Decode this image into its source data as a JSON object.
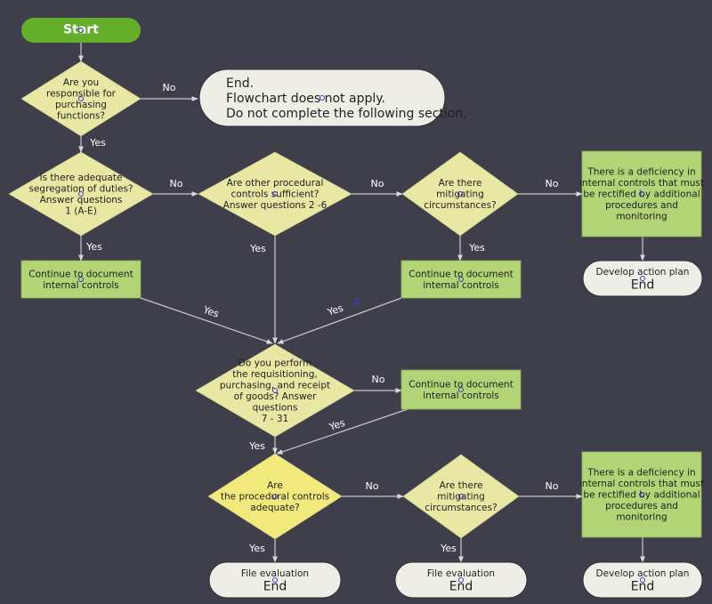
{
  "diagram": {
    "colors": {
      "background": "#3f3f4b",
      "start": "#65ae2c",
      "decision": "#e8e8a4",
      "decision_highlight": "#f2e97c",
      "process": "#b2d376",
      "terminal": "#efeee6",
      "edge": "#c8c8c8"
    },
    "nodes": [
      {
        "id": "start",
        "type": "start",
        "lines": [
          "Start"
        ]
      },
      {
        "id": "q-responsible",
        "type": "decision",
        "lines": [
          "Are you",
          "responsible for",
          "purchasing",
          "functions?"
        ]
      },
      {
        "id": "end-not-apply",
        "type": "terminal",
        "lines": [
          "End.",
          "Flowchart does not apply.",
          "Do not complete the following section."
        ]
      },
      {
        "id": "q-segregation",
        "type": "decision",
        "lines": [
          "Is there adequate",
          "segregation of duties?",
          "Answer questions",
          "1 (A-E)"
        ]
      },
      {
        "id": "q-other-controls",
        "type": "decision",
        "lines": [
          "Are other procedural",
          "controls sufficient?",
          "Answer questions 2 -6"
        ]
      },
      {
        "id": "q-mitigating-1",
        "type": "decision",
        "lines": [
          "Are there",
          "mitigating",
          "circumstances?"
        ]
      },
      {
        "id": "deficiency-1",
        "type": "process",
        "lines": [
          "There is a deficiency in",
          "internal controls that must",
          "be rectified by additional",
          "procedures and",
          "monitoring"
        ]
      },
      {
        "id": "continue-1",
        "type": "process",
        "lines": [
          "Continue to document",
          "internal controls"
        ]
      },
      {
        "id": "continue-2",
        "type": "process",
        "lines": [
          "Continue to document",
          "internal controls"
        ]
      },
      {
        "id": "action-plan-1",
        "type": "terminal",
        "lines": [
          "Develop action plan"
        ],
        "sub": "End"
      },
      {
        "id": "q-requisitioning",
        "type": "decision",
        "lines": [
          "Do you perform",
          "the requisitioning,",
          "purchasing, and receipt",
          "of goods? Answer",
          "questions",
          "7 - 31"
        ]
      },
      {
        "id": "continue-3",
        "type": "process",
        "lines": [
          "Continue to document",
          "internal controls"
        ]
      },
      {
        "id": "q-procedural-adequate",
        "type": "decision_highlight",
        "lines": [
          "Are",
          "the procedural controls",
          "adequate?"
        ]
      },
      {
        "id": "q-mitigating-2",
        "type": "decision",
        "lines": [
          "Are there",
          "mitigating",
          "circumstances?"
        ]
      },
      {
        "id": "deficiency-2",
        "type": "process",
        "lines": [
          "There is a deficiency in",
          "internal controls that must",
          "be rectified by additional",
          "procedures and",
          "monitoring"
        ]
      },
      {
        "id": "file-eval-1",
        "type": "terminal",
        "lines": [
          "File evaluation"
        ],
        "sub": "End"
      },
      {
        "id": "file-eval-2",
        "type": "terminal",
        "lines": [
          "File evaluation"
        ],
        "sub": "End"
      },
      {
        "id": "action-plan-2",
        "type": "terminal",
        "lines": [
          "Develop action plan"
        ],
        "sub": "End"
      }
    ],
    "edges": [
      {
        "from": "start",
        "to": "q-responsible",
        "label": ""
      },
      {
        "from": "q-responsible",
        "to": "end-not-apply",
        "label": "No"
      },
      {
        "from": "q-responsible",
        "to": "q-segregation",
        "label": "Yes"
      },
      {
        "from": "q-segregation",
        "to": "q-other-controls",
        "label": "No"
      },
      {
        "from": "q-segregation",
        "to": "continue-1",
        "label": "Yes"
      },
      {
        "from": "q-other-controls",
        "to": "q-mitigating-1",
        "label": "No"
      },
      {
        "from": "q-other-controls",
        "to": "q-requisitioning",
        "label": "Yes"
      },
      {
        "from": "q-mitigating-1",
        "to": "deficiency-1",
        "label": "No"
      },
      {
        "from": "q-mitigating-1",
        "to": "continue-2",
        "label": "Yes"
      },
      {
        "from": "deficiency-1",
        "to": "action-plan-1",
        "label": ""
      },
      {
        "from": "continue-1",
        "to": "q-requisitioning",
        "label": "Yes"
      },
      {
        "from": "continue-2",
        "to": "q-requisitioning",
        "label": "Yes"
      },
      {
        "from": "q-requisitioning",
        "to": "continue-3",
        "label": "No"
      },
      {
        "from": "q-requisitioning",
        "to": "q-procedural-adequate",
        "label": "Yes"
      },
      {
        "from": "continue-3",
        "to": "q-procedural-adequate",
        "label": "Yes"
      },
      {
        "from": "q-procedural-adequate",
        "to": "q-mitigating-2",
        "label": "No"
      },
      {
        "from": "q-procedural-adequate",
        "to": "file-eval-1",
        "label": "Yes"
      },
      {
        "from": "q-mitigating-2",
        "to": "deficiency-2",
        "label": "No"
      },
      {
        "from": "q-mitigating-2",
        "to": "file-eval-2",
        "label": "Yes"
      },
      {
        "from": "deficiency-2",
        "to": "action-plan-2",
        "label": ""
      }
    ]
  }
}
